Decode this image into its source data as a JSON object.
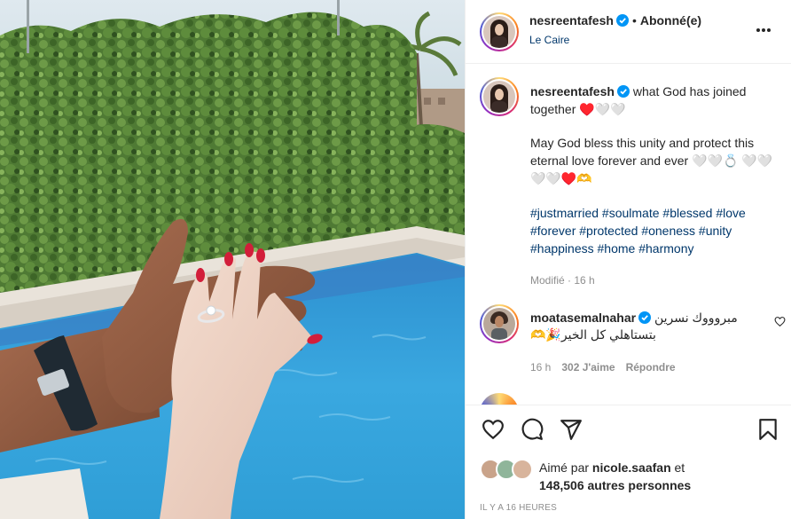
{
  "post": {
    "author": {
      "username": "nesreentafesh",
      "verified": true,
      "location": "Le Caire",
      "follow_status": "Abonné(e)",
      "separator": "•"
    },
    "caption": {
      "username": "nesreentafesh",
      "line1": "what God has joined together ♥️🤍🤍",
      "line2": "May God bless this unity and protect this eternal love forever and ever 🤍🤍💍 🤍🤍🤍🤍♥️🫶",
      "hashtags": [
        "#justmarried",
        "#soulmate",
        "#blessed",
        "#love",
        "#forever",
        "#protected",
        "#oneness",
        "#unity",
        "#happiness",
        "#home",
        "#harmony"
      ],
      "edited": "Modifié",
      "time": "16 h"
    },
    "comments": [
      {
        "username": "moatasemalnahar",
        "verified": true,
        "text": "مبروووك نسرين بتستاهلي كل الخير🎉🫶",
        "time": "16 h",
        "likes": "302 J'aime",
        "reply": "Répondre"
      }
    ],
    "likes": {
      "liked_by_prefix": "Aimé par",
      "liked_by_user": "nicole.saafan",
      "and": "et",
      "others_count": "148,506 autres personnes"
    },
    "timestamp": "IL Y A 16 HEURES",
    "actions": [
      "like-icon",
      "comment-icon",
      "share-icon",
      "save-icon"
    ],
    "colors": {
      "link": "#00376b",
      "verified": "#0095f6",
      "muted": "#8e8e8e",
      "text": "#262626",
      "nail": "#d21e3a",
      "pool": "#2f9ed6"
    }
  }
}
